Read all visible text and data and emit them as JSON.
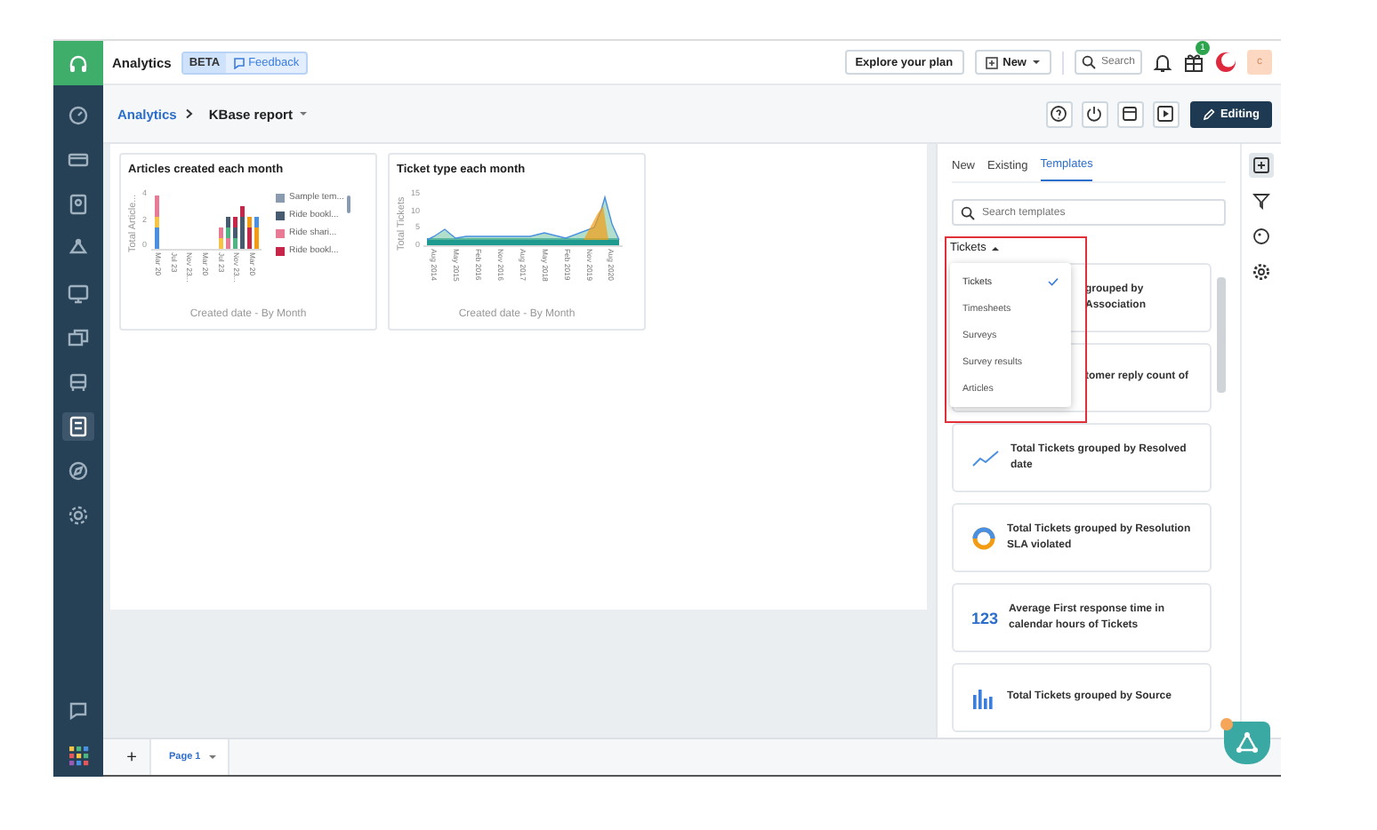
{
  "header": {
    "title": "Analytics",
    "badge": "BETA",
    "feedback": "Feedback",
    "plan_button": "Explore your plan",
    "new_button": "New",
    "search_placeholder": "Search",
    "notification_count": "1",
    "avatar": "c"
  },
  "sidebar": {
    "items": [
      {
        "selected": false
      },
      {
        "selected": false
      },
      {
        "selected": false
      },
      {
        "selected": false
      },
      {
        "selected": false
      },
      {
        "selected": false
      },
      {
        "selected": false
      },
      {
        "selected": true
      },
      {
        "selected": false
      },
      {
        "selected": false
      }
    ]
  },
  "breadcrumb": {
    "root": "Analytics",
    "current": "KBase report"
  },
  "editing_button": "Editing",
  "widgets": [
    {
      "title": "Articles created each month",
      "ylabel": "Total Article...",
      "xlabel": "Created date - By Month",
      "yticks": [
        "4",
        "2",
        "0"
      ],
      "xticks": [
        "Mar 20",
        "Jul 23",
        "Nov 23...",
        "Mar 20",
        "Jul 23",
        "Nov 23...",
        "Mar 20"
      ],
      "legend": [
        {
          "label": "Sample tem...",
          "color": "#8a9bb0"
        },
        {
          "label": "Ride bookl...",
          "color": "#475b70"
        },
        {
          "label": "Ride shari...",
          "color": "#e87a96"
        },
        {
          "label": "Ride bookl...",
          "color": "#c8254a"
        }
      ]
    },
    {
      "title": "Ticket type each month",
      "ylabel": "Total Tickets",
      "xlabel": "Created date - By Month",
      "yticks": [
        "15",
        "10",
        "5",
        "0"
      ],
      "xticks": [
        "Aug 2014",
        "May 2015",
        "Feb 2016",
        "Nov 2016",
        "Aug 2017",
        "May 2018",
        "Feb 2019",
        "Nov 2019",
        "Aug 2020"
      ]
    }
  ],
  "panel": {
    "tabs": [
      {
        "label": "New",
        "selected": false
      },
      {
        "label": "Existing",
        "selected": false
      },
      {
        "label": "Templates",
        "selected": true
      }
    ],
    "search_placeholder": "Search templates",
    "filter": "Tickets",
    "dropdown": [
      {
        "label": "Tickets",
        "selected": true
      },
      {
        "label": "Timesheets",
        "selected": false
      },
      {
        "label": "Surveys",
        "selected": false
      },
      {
        "label": "Survey results",
        "selected": false
      },
      {
        "label": "Articles",
        "selected": false
      }
    ],
    "templates": [
      {
        "kind": "covered",
        "text": "grouped by Association"
      },
      {
        "kind": "covered",
        "text": "tomer reply count of"
      },
      {
        "kind": "line",
        "text": "Total Tickets grouped by Resolved date"
      },
      {
        "kind": "donut",
        "text": "Total Tickets grouped by Resolution SLA violated"
      },
      {
        "kind": "number",
        "icon_text": "123",
        "text": "Average First response time in calendar hours of Tickets"
      },
      {
        "kind": "bar",
        "text": "Total Tickets grouped by Source"
      }
    ]
  },
  "pages": {
    "add": "+",
    "tabs": [
      {
        "label": "Page 1",
        "selected": true
      }
    ]
  }
}
